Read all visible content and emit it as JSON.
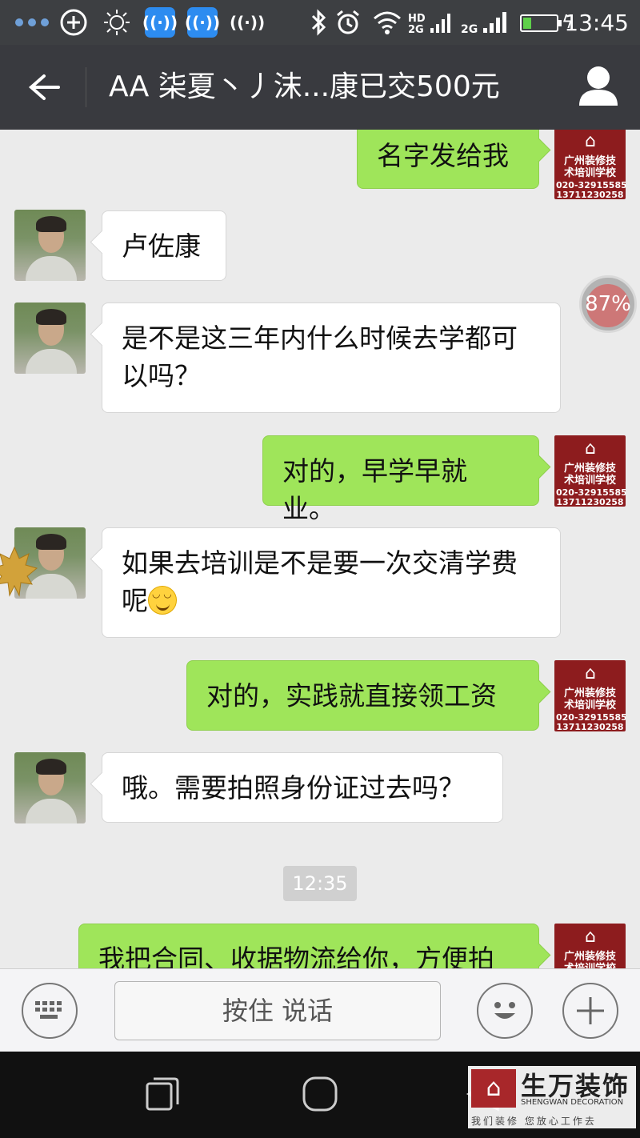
{
  "status_bar": {
    "time": "13:45",
    "network_label": "2G",
    "icons": [
      "more-dots-icon",
      "plus-shield-icon",
      "brightness-icon",
      "wifi-app-icon",
      "wifi-app-icon",
      "wifi-signal-app-icon",
      "bluetooth-icon",
      "alarm-icon",
      "wifi-icon",
      "hd-signal-icon",
      "signal-2g-icon",
      "battery-icon"
    ],
    "battery_level": 0.15
  },
  "header": {
    "title": "AA  柒夏丶丿沫...康已交500元",
    "back_icon": "back-arrow-icon",
    "profile_icon": "person-icon"
  },
  "my_avatar": {
    "line1": "广州装修技",
    "line2": "术培训学校",
    "line3": "020-32915585",
    "line4": "13711230258"
  },
  "messages": [
    {
      "side": "me",
      "text": "名字发给我"
    },
    {
      "side": "them",
      "text": "卢佐康"
    },
    {
      "side": "them",
      "text": "是不是这三年内什么时候去学都可以吗？"
    },
    {
      "side": "me",
      "text": "对的，早学早就业。"
    },
    {
      "side": "them",
      "text": "如果去培训是不是要一次交清学费呢",
      "emoji": "smile-emoji-icon"
    },
    {
      "side": "me",
      "text": "对的，实践就直接领工资"
    },
    {
      "side": "them",
      "text": "哦。需要拍照身份证过去吗？"
    },
    {
      "side": "me",
      "text": "我把合同、收据物流给你，方便拍"
    }
  ],
  "timestamp": "12:35",
  "floating_widget": {
    "label": "87%"
  },
  "input_bar": {
    "hold_to_talk": "按住 说话",
    "keyboard_icon": "keyboard-icon",
    "emoji_icon": "smiley-icon",
    "plus_icon": "plus-icon"
  },
  "nav_bar": {
    "icons": [
      "recent-apps-icon",
      "home-icon",
      "back-triangle-icon"
    ]
  },
  "watermark": {
    "brand_cn": "生万装饰",
    "brand_en": "SHENGWAN DECORATION",
    "slogan": "我们装修 您放心工作去"
  },
  "colors": {
    "title_bar": "#393a3f",
    "status_bar": "#3d3f42",
    "chat_bg": "#ebebeb",
    "my_bubble": "#9fe55a",
    "their_bubble": "#ffffff",
    "my_avatar_bg": "#8d1c1e"
  }
}
